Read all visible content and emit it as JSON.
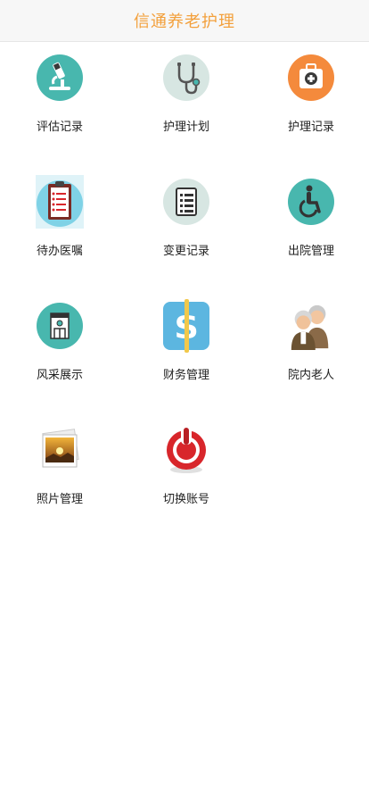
{
  "app": {
    "title": "信通养老护理"
  },
  "menu": {
    "items": [
      {
        "id": "assessment",
        "label": "评估记录",
        "icon": "microscope-icon"
      },
      {
        "id": "care-plan",
        "label": "护理计划",
        "icon": "stethoscope-icon"
      },
      {
        "id": "care-record",
        "label": "护理记录",
        "icon": "medical-kit-icon"
      },
      {
        "id": "pending-orders",
        "label": "待办医嘱",
        "icon": "clipboard-icon"
      },
      {
        "id": "change-record",
        "label": "变更记录",
        "icon": "list-document-icon"
      },
      {
        "id": "discharge",
        "label": "出院管理",
        "icon": "wheelchair-icon"
      },
      {
        "id": "showcase",
        "label": "风采展示",
        "icon": "building-icon"
      },
      {
        "id": "finance",
        "label": "财务管理",
        "icon": "dollar-icon"
      },
      {
        "id": "residents",
        "label": "院内老人",
        "icon": "elderly-couple-icon"
      },
      {
        "id": "photos",
        "label": "照片管理",
        "icon": "photo-stack-icon"
      },
      {
        "id": "switch-account",
        "label": "切换账号",
        "icon": "power-icon"
      }
    ]
  },
  "colors": {
    "title": "#f3a03c",
    "teal": "#48b7ae",
    "pale_teal": "#d7e6e2",
    "orange": "#f48a3c",
    "blue": "#5cb6e0",
    "red": "#d8262b"
  }
}
